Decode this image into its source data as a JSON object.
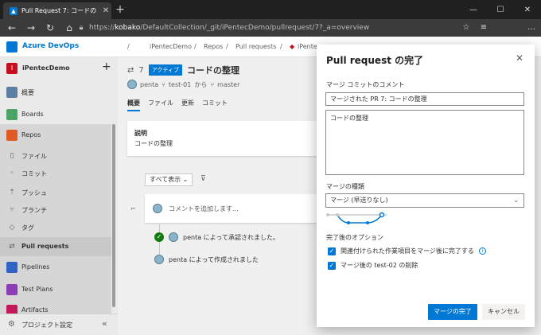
{
  "browser": {
    "tab_title": "Pull Request 7: コードの整理",
    "url_prefix": "https://",
    "url_host": "kobako",
    "url_path": "/DefaultCollection/_git/iPentecDemo/pullrequest/7?_a=overview"
  },
  "header": {
    "brand": "Azure DevOps",
    "crumbs": [
      "iPentecDemo",
      "Repos",
      "Pull requests",
      "iPente"
    ]
  },
  "sidebar": {
    "project_badge": "I",
    "project_name": "iPentecDemo",
    "items": [
      {
        "label": "概要",
        "color": "#5c7fa3"
      },
      {
        "label": "Boards",
        "color": "#4aa564"
      },
      {
        "label": "Repos",
        "color": "#e05a26"
      },
      {
        "label": "ファイル"
      },
      {
        "label": "コミット"
      },
      {
        "label": "プッシュ"
      },
      {
        "label": "ブランチ"
      },
      {
        "label": "タグ"
      },
      {
        "label": "Pull requests"
      },
      {
        "label": "Pipelines",
        "color": "#2f63c4"
      },
      {
        "label": "Test Plans",
        "color": "#8a3db4"
      },
      {
        "label": "Artifacts",
        "color": "#c2185b"
      }
    ],
    "settings_label": "プロジェクト設定"
  },
  "pr": {
    "number": "7",
    "status_badge": "アクティブ",
    "title": "コードの整理",
    "author": "penta",
    "source_branch": "test-01",
    "from_text": "から",
    "target_branch": "master",
    "tabs": [
      "概要",
      "ファイル",
      "更新",
      "コミット"
    ],
    "description_heading": "説明",
    "description_text": "コードの整理",
    "filter_label": "すべて表示",
    "comment_placeholder": "コメントを追加します...",
    "timeline": [
      "penta によって承認されました。",
      "penta によって作成されました"
    ]
  },
  "dialog": {
    "title": "Pull request の完了",
    "commit_comment_label": "マージ コミットのコメント",
    "commit_comment_value": "マージされた PR 7: コードの整理",
    "commit_body": "コードの整理",
    "merge_type_label": "マージの種類",
    "merge_type_value": "マージ (早送りなし)",
    "options_label": "完了後のオプション",
    "options": [
      "関連付けられた作業項目をマージ後に完了する",
      "マージ後の test-02 の削除"
    ],
    "complete_button": "マージの完了",
    "cancel_button": "キャンセル"
  },
  "colors": {
    "accent": "#0078d4",
    "approved": "#107c10"
  }
}
